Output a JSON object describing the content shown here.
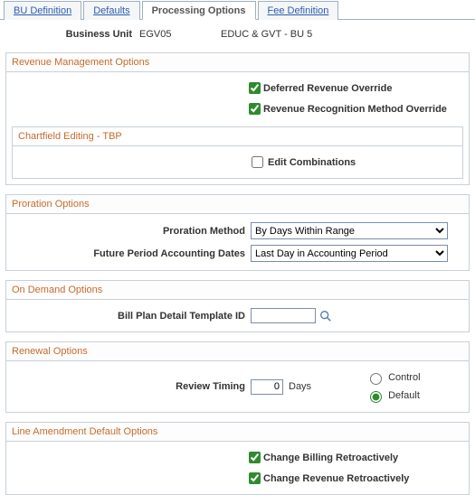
{
  "tabs": {
    "bu_definition": "BU Definition",
    "defaults": "Defaults",
    "processing_options": "Processing Options",
    "fee_definition": "Fee Definition"
  },
  "header": {
    "bu_label": "Business Unit",
    "bu_value": "EGV05",
    "bu_desc": "EDUC & GVT - BU 5"
  },
  "revenue_mgmt": {
    "title": "Revenue Management Options",
    "deferred_override_label": "Deferred Revenue Override",
    "deferred_override_checked": true,
    "recognition_override_label": "Revenue Recognition Method Override",
    "recognition_override_checked": true,
    "chartfield_title": "Chartfield Editing - TBP",
    "edit_combinations_label": "Edit Combinations",
    "edit_combinations_checked": false
  },
  "proration": {
    "title": "Proration Options",
    "method_label": "Proration Method",
    "method_value": "By Days Within Range",
    "future_dates_label": "Future Period Accounting Dates",
    "future_dates_value": "Last Day in Accounting Period"
  },
  "on_demand": {
    "title": "On Demand Options",
    "template_label": "Bill Plan Detail Template ID",
    "template_value": ""
  },
  "renewal": {
    "title": "Renewal Options",
    "review_timing_label": "Review Timing",
    "review_timing_value": "0",
    "days_label": "Days",
    "control_label": "Control",
    "default_label": "Default",
    "selected": "default"
  },
  "line_amend": {
    "title": "Line Amendment Default Options",
    "change_billing_label": "Change Billing Retroactively",
    "change_billing_checked": true,
    "change_revenue_label": "Change Revenue Retroactively",
    "change_revenue_checked": true
  }
}
